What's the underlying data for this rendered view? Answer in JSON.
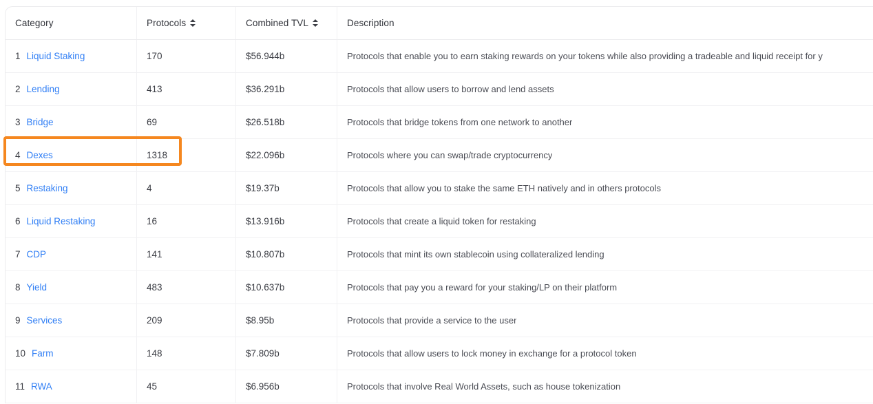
{
  "table": {
    "columns": [
      {
        "key": "category",
        "label": "Category",
        "sortable": false,
        "sort_icon": "sort-updown-icon"
      },
      {
        "key": "protocols",
        "label": "Protocols",
        "sortable": true,
        "sort_icon": "sort-updown-icon"
      },
      {
        "key": "tvl",
        "label": "Combined TVL",
        "sortable": true,
        "sort_icon": "sort-updown-icon"
      },
      {
        "key": "desc",
        "label": "Description",
        "sortable": false,
        "sort_icon": ""
      }
    ],
    "rows": [
      {
        "rank": "1",
        "category": "Liquid Staking",
        "protocols": "170",
        "tvl": "$56.944b",
        "description": "Protocols that enable you to earn staking rewards on your tokens while also providing a tradeable and liquid receipt for y"
      },
      {
        "rank": "2",
        "category": "Lending",
        "protocols": "413",
        "tvl": "$36.291b",
        "description": "Protocols that allow users to borrow and lend assets"
      },
      {
        "rank": "3",
        "category": "Bridge",
        "protocols": "69",
        "tvl": "$26.518b",
        "description": "Protocols that bridge tokens from one network to another"
      },
      {
        "rank": "4",
        "category": "Dexes",
        "protocols": "1318",
        "tvl": "$22.096b",
        "description": "Protocols where you can swap/trade cryptocurrency"
      },
      {
        "rank": "5",
        "category": "Restaking",
        "protocols": "4",
        "tvl": "$19.37b",
        "description": "Protocols that allow you to stake the same ETH natively and in others protocols"
      },
      {
        "rank": "6",
        "category": "Liquid Restaking",
        "protocols": "16",
        "tvl": "$13.916b",
        "description": "Protocols that create a liquid token for restaking"
      },
      {
        "rank": "7",
        "category": "CDP",
        "protocols": "141",
        "tvl": "$10.807b",
        "description": "Protocols that mint its own stablecoin using collateralized lending"
      },
      {
        "rank": "8",
        "category": "Yield",
        "protocols": "483",
        "tvl": "$10.637b",
        "description": "Protocols that pay you a reward for your staking/LP on their platform"
      },
      {
        "rank": "9",
        "category": "Services",
        "protocols": "209",
        "tvl": "$8.95b",
        "description": "Protocols that provide a service to the user"
      },
      {
        "rank": "10",
        "category": "Farm",
        "protocols": "148",
        "tvl": "$7.809b",
        "description": "Protocols that allow users to lock money in exchange for a protocol token"
      },
      {
        "rank": "11",
        "category": "RWA",
        "protocols": "45",
        "tvl": "$6.956b",
        "description": "Protocols that involve Real World Assets, such as house tokenization"
      }
    ]
  },
  "annotation": {
    "highlight_target_rank": "4",
    "highlight_target_category": "Dexes",
    "highlight_color": "#f5871f"
  },
  "colors": {
    "link": "#2f7ef5",
    "text": "#3b3d44",
    "muted": "#4a4c54",
    "divider": "#f1f1f3",
    "background": "#ffffff"
  }
}
